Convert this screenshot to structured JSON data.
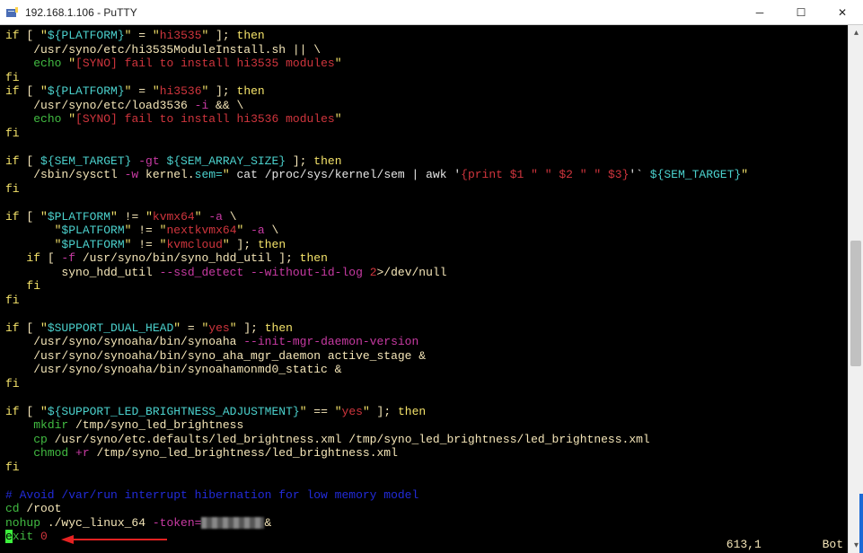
{
  "window": {
    "title": "192.168.1.106 - PuTTY",
    "min_sym": "─",
    "max_sym": "☐",
    "close_sym": "✕"
  },
  "status": {
    "pos": "613,1",
    "mode": "Bot"
  },
  "code": {
    "l01a": "if",
    "l01b": " [ ",
    "l01q": "\"",
    "l01v": "${PLATFORM}",
    "l01q2": "\"",
    "l01eq": " = ",
    "l01q3": "\"",
    "l01s": "hi3535",
    "l01q4": "\"",
    "l01e": " ]; ",
    "l01t": "then",
    "l02a": "    /usr/syno/etc/hi3535ModuleInstall.sh || \\",
    "l03a": "    ",
    "l03e": "echo",
    "l03q": " \"",
    "l03s": "[SYNO] fail to install hi3535 modules",
    "l03q2": "\"",
    "l04": "fi",
    "l05a": "if",
    "l05b": " [ ",
    "l05q": "\"",
    "l05v": "${PLATFORM}",
    "l05q2": "\"",
    "l05eq": " = ",
    "l05q3": "\"",
    "l05s": "hi3536",
    "l05q4": "\"",
    "l05e": " ]; ",
    "l05t": "then",
    "l06": "    /usr/syno/etc/load3536 ",
    "l06f": "-i",
    "l06r": " && \\",
    "l07a": "    ",
    "l07e": "echo",
    "l07q": " \"",
    "l07s": "[SYNO] fail to install hi3536 modules",
    "l07q2": "\"",
    "l08": "fi",
    "l10a": "if",
    "l10b": " [ ",
    "l10v": "${SEM_TARGET}",
    "l10g": " -gt ",
    "l10v2": "${SEM_ARRAY_SIZE}",
    "l10e": " ]; ",
    "l10t": "then",
    "l11a": "    /sbin/sysctl ",
    "l11w": "-w",
    "l11b": " kernel.",
    "l11sem": "sem=",
    "l11q": "\"",
    "l11c": " cat /proc/sys/kernel/sem | awk '",
    "l11aw": "{print $1 \" \" $2 \" \" $3}",
    "l11c2": "'` ",
    "l11v": "${SEM_TARGET}",
    "l11q2": "\"",
    "l12": "fi",
    "l14a": "if",
    "l14b": " [ ",
    "l14q": "\"",
    "l14v": "$PLATFORM",
    "l14q2": "\"",
    "l14ne": " != ",
    "l14q3": "\"",
    "l14s": "kvmx64",
    "l14q4": "\"",
    "l14a2": " -a",
    "l14bs": " \\",
    "l15a": "       ",
    "l15q": "\"",
    "l15v": "$PLATFORM",
    "l15q2": "\"",
    "l15ne": " != ",
    "l15q3": "\"",
    "l15s": "nextkvmx64",
    "l15q4": "\"",
    "l15a2": " -a",
    "l15bs": " \\",
    "l16a": "       ",
    "l16q": "\"",
    "l16v": "$PLATFORM",
    "l16q2": "\"",
    "l16ne": " != ",
    "l16q3": "\"",
    "l16s": "kvmcloud",
    "l16q4": "\"",
    "l16e": " ]; ",
    "l16t": "then",
    "l17a": "   ",
    "l17i": "if",
    "l17b": " [ ",
    "l17f": "-f",
    "l17p": " /usr/syno/bin/syno_hdd_util ]; ",
    "l17t": "then",
    "l18a": "        syno_hdd_util ",
    "l18f": "--ssd_detect --without-id-log",
    "l18n": " 2",
    "l18r": ">/dev/null",
    "l19": "   ",
    "l19f": "fi",
    "l20": "fi",
    "l22a": "if",
    "l22b": " [ ",
    "l22q": "\"",
    "l22v": "$SUPPORT_DUAL_HEAD",
    "l22q2": "\"",
    "l22eq": " = ",
    "l22q3": "\"",
    "l22s": "yes",
    "l22q4": "\"",
    "l22e": " ]; ",
    "l22t": "then",
    "l23a": "    /usr/syno/synoaha/bin/synoaha ",
    "l23f": "--init-mgr-daemon-version",
    "l24": "    /usr/syno/synoaha/bin/syno_aha_mgr_daemon active_stage &",
    "l25": "    /usr/syno/synoaha/bin/synoahamonmd0_static &",
    "l26": "fi",
    "l28a": "if",
    "l28b": " [ ",
    "l28q": "\"",
    "l28v": "${SUPPORT_LED_BRIGHTNESS_ADJUSTMENT}",
    "l28q2": "\"",
    "l28eq": " == ",
    "l28q3": "\"",
    "l28s": "yes",
    "l28q4": "\"",
    "l28e": " ]; ",
    "l28t": "then",
    "l29a": "    ",
    "l29m": "mkdir",
    "l29p": " /tmp/syno_led_brightness",
    "l30a": "    ",
    "l30c": "cp",
    "l30p": " /usr/syno/etc.defaults/led_brightness.xml /tmp/syno_led_brightness/led_brightness.xml",
    "l31a": "    ",
    "l31c": "chmod",
    "l31f": " +r",
    "l31p": " /tmp/syno_led_brightness/led_brightness.xml",
    "l32": "fi",
    "l34": "# Avoid /var/run interrupt hibernation for low memory model",
    "l35a": "cd",
    "l35p": " /root",
    "l36a": "nohup",
    "l36p": " ./wyc_linux_64 ",
    "l36f": "-token=",
    "l36amp": "&",
    "l37e": "e",
    "l37x": "xit ",
    "l37n": "0"
  }
}
